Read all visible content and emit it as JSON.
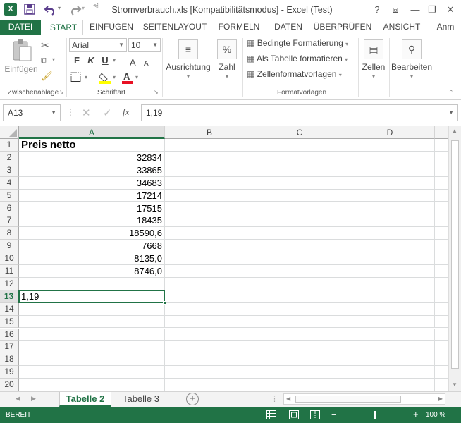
{
  "window": {
    "title": "Stromverbrauch.xls  [Kompatibilitätsmodus] - Excel (Test)",
    "app_icon": "X",
    "help": "?",
    "ribbon_display": "⧈",
    "minimize": "—",
    "restore": "❐",
    "close": "✕"
  },
  "quick_access": {
    "save": "save-icon",
    "undo": "undo-icon",
    "redo": "redo-icon"
  },
  "tabs": {
    "file": "DATEI",
    "start": "START",
    "insert": "EINFÜGEN",
    "pagelayout": "SEITENLAYOUT",
    "formulas": "FORMELN",
    "data": "DATEN",
    "review": "ÜBERPRÜFEN",
    "view": "ANSICHT",
    "more": "Anm"
  },
  "ribbon": {
    "clipboard": {
      "paste": "Einfügen",
      "label": "Zwischenablage"
    },
    "font": {
      "name": "Arial",
      "size": "10",
      "bold": "F",
      "italic": "K",
      "underline": "U",
      "label": "Schriftart",
      "fill_color": "#ffff00",
      "font_color": "#e81123"
    },
    "alignment": {
      "label": "Ausrichtung"
    },
    "number": {
      "label": "Zahl",
      "symbol": "%"
    },
    "styles": {
      "conditional": "Bedingte Formatierung",
      "as_table": "Als Tabelle formatieren",
      "cell_styles": "Zellenformatvorlagen",
      "label": "Formatvorlagen"
    },
    "cells": {
      "label": "Zellen"
    },
    "editing": {
      "label": "Bearbeiten"
    }
  },
  "formula_bar": {
    "name_box": "A13",
    "fx": "fx",
    "value": "1,19"
  },
  "columns": [
    "A",
    "B",
    "C",
    "D"
  ],
  "rows": [
    {
      "n": "1",
      "a": "Preis netto"
    },
    {
      "n": "2",
      "a": "32834"
    },
    {
      "n": "3",
      "a": "33865"
    },
    {
      "n": "4",
      "a": "34683"
    },
    {
      "n": "5",
      "a": "17214"
    },
    {
      "n": "6",
      "a": "17515"
    },
    {
      "n": "7",
      "a": "18435"
    },
    {
      "n": "8",
      "a": "18590,6"
    },
    {
      "n": "9",
      "a": "7668"
    },
    {
      "n": "10",
      "a": "8135,0"
    },
    {
      "n": "11",
      "a": "8746,0"
    },
    {
      "n": "12",
      "a": ""
    },
    {
      "n": "13",
      "a": "1,19"
    },
    {
      "n": "14",
      "a": ""
    },
    {
      "n": "15",
      "a": ""
    },
    {
      "n": "16",
      "a": ""
    },
    {
      "n": "17",
      "a": ""
    },
    {
      "n": "18",
      "a": ""
    },
    {
      "n": "19",
      "a": ""
    },
    {
      "n": "20",
      "a": ""
    }
  ],
  "active_cell": "A13",
  "sheets": [
    {
      "name": "Tabelle 2",
      "active": true
    },
    {
      "name": "Tabelle 3",
      "active": false
    }
  ],
  "status": {
    "ready": "BEREIT",
    "zoom": "100 %"
  },
  "colors": {
    "accent": "#217346"
  }
}
